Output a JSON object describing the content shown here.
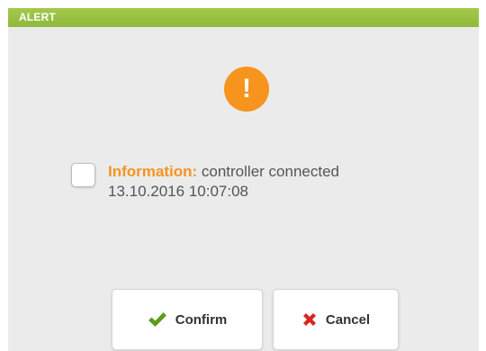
{
  "dialog": {
    "title": "ALERT",
    "alert_icon_glyph": "!",
    "alert_icon": "exclamation-icon",
    "message": {
      "label": "Information:",
      "text": "controller connected",
      "timestamp": "13.10.2016 10:07:08"
    },
    "checkbox_checked": false
  },
  "buttons": {
    "confirm_label": "Confirm",
    "confirm_icon": "checkmark-icon",
    "cancel_label": "Cancel",
    "cancel_icon": "close-icon"
  },
  "colors": {
    "titlebar": "#9bc244",
    "accent_orange": "#f7941d",
    "confirm_icon": "#5e9c1f",
    "cancel_icon": "#d7261e",
    "background": "#ebebeb"
  }
}
